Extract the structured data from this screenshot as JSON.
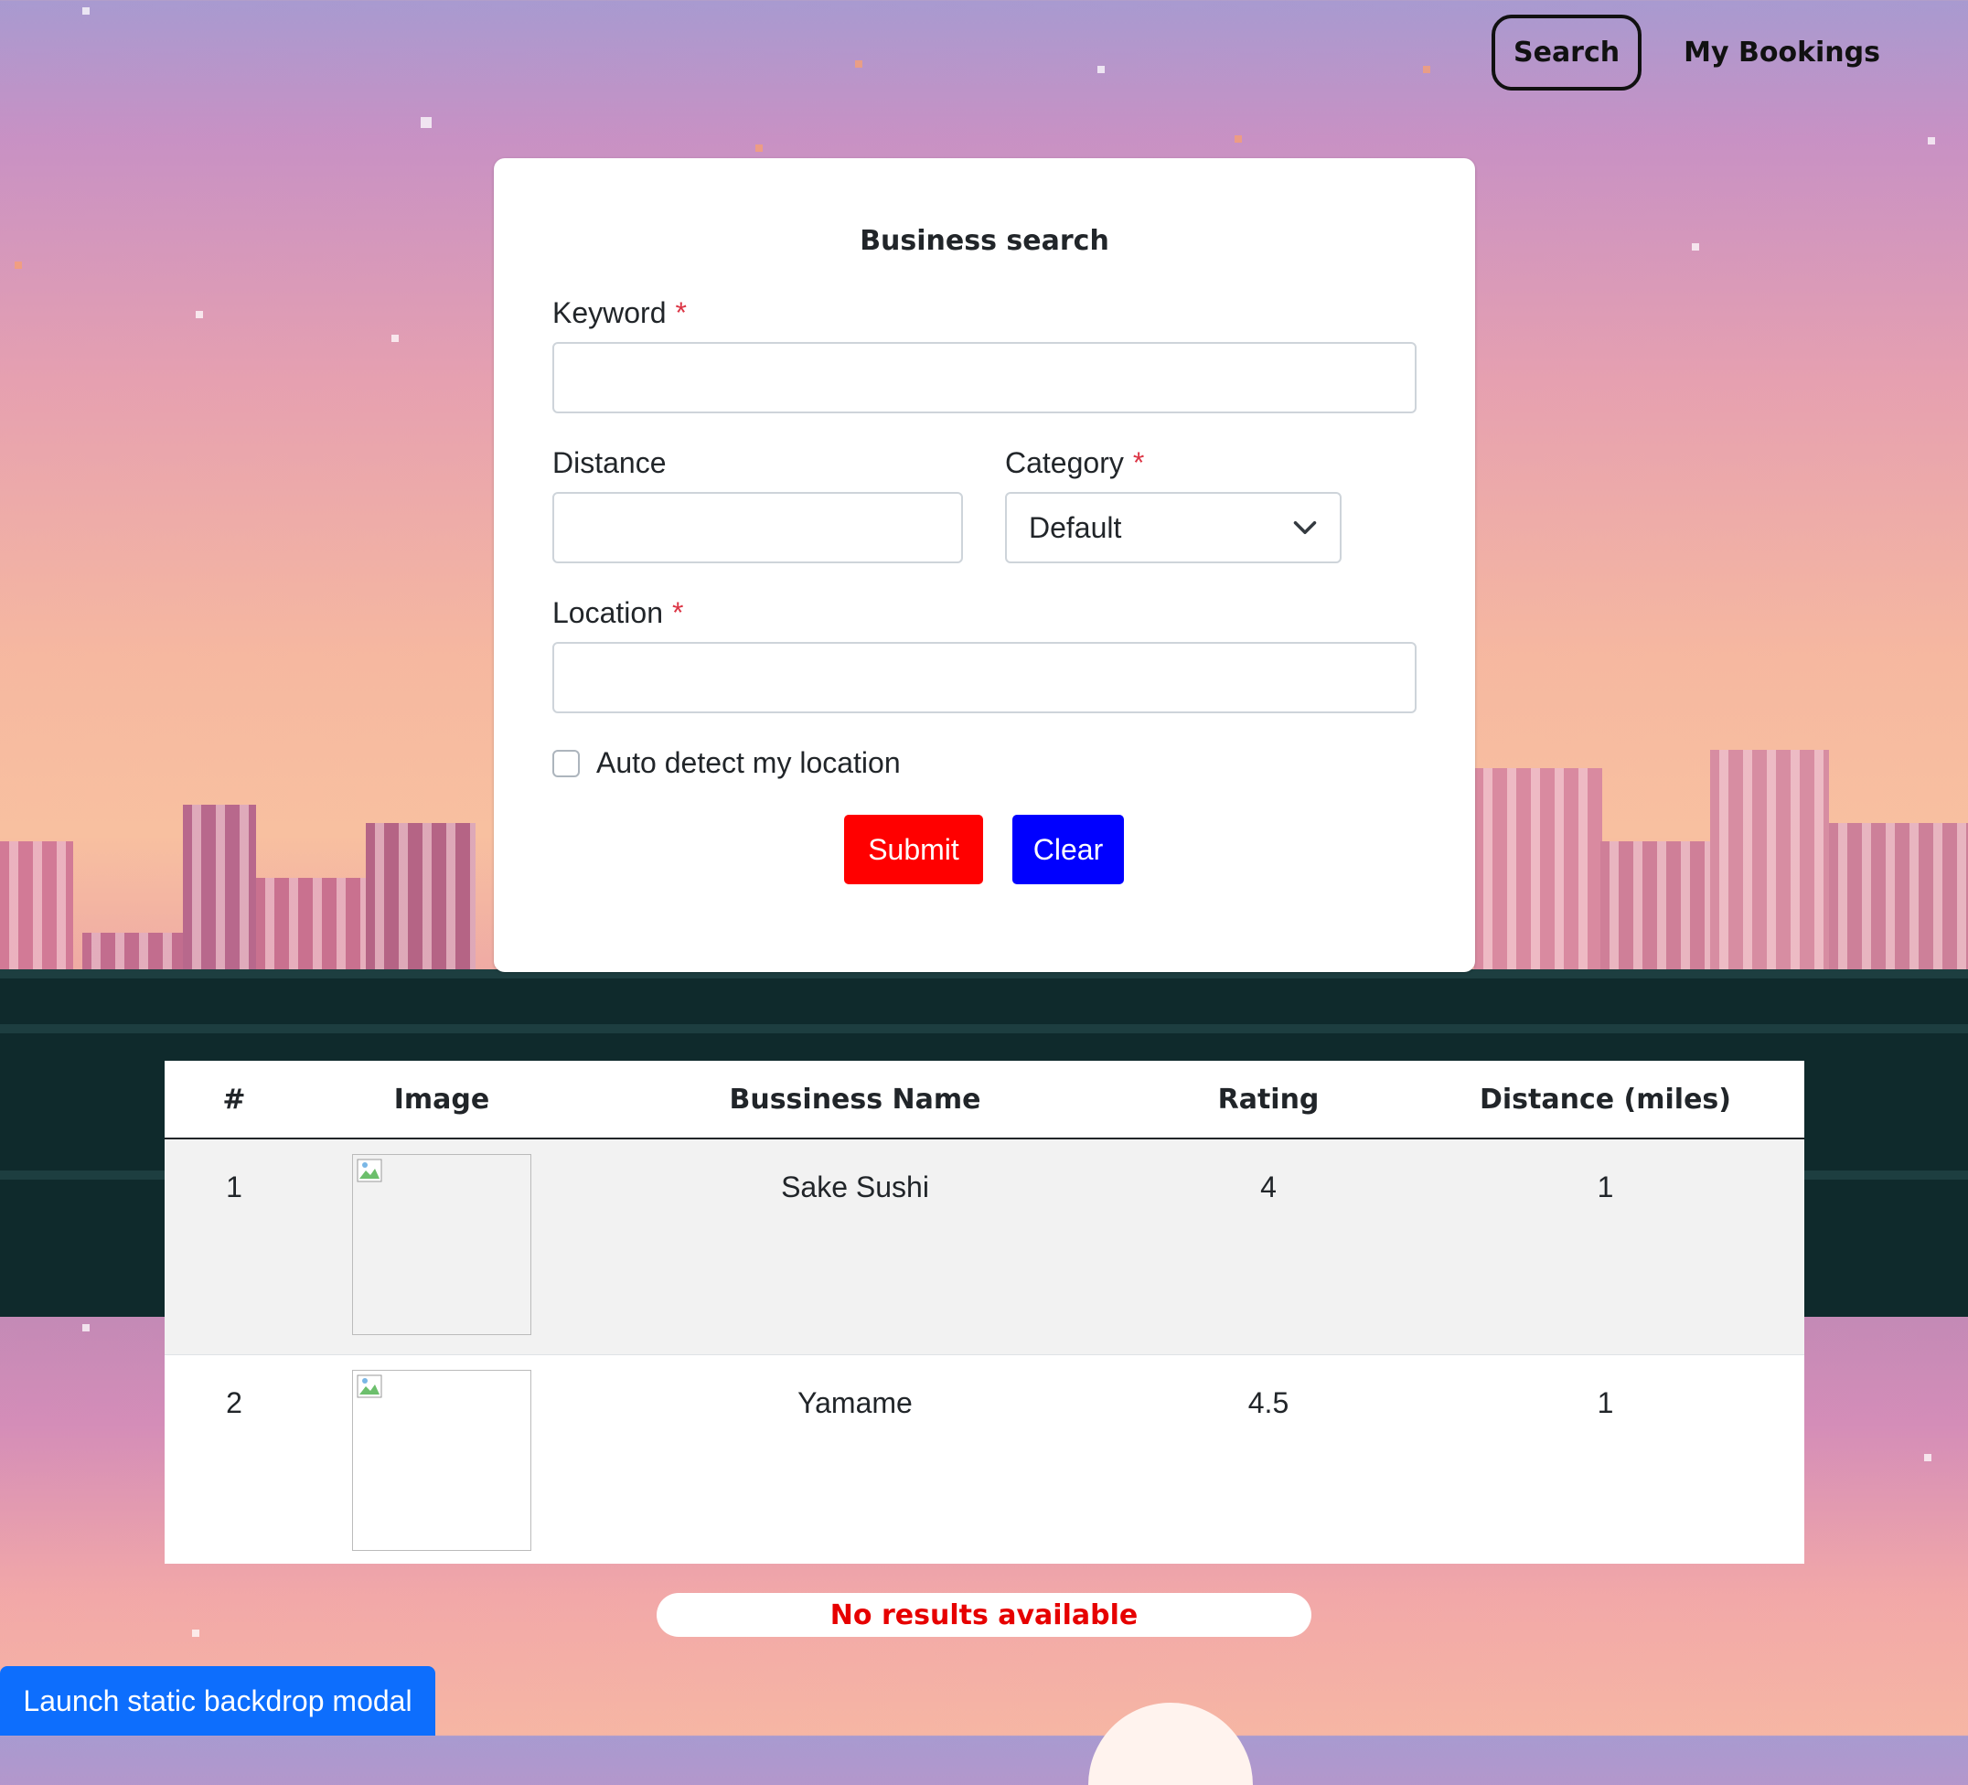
{
  "nav": {
    "search_label": "Search",
    "bookings_label": "My Bookings"
  },
  "form": {
    "title": "Business search",
    "keyword_label": "Keyword",
    "keyword_value": "",
    "distance_label": "Distance",
    "distance_value": "",
    "category_label": "Category",
    "category_selected": "Default",
    "location_label": "Location",
    "location_value": "",
    "required_mark": "*",
    "auto_detect_label": "Auto detect my location",
    "auto_detect_checked": false,
    "submit_label": "Submit",
    "clear_label": "Clear"
  },
  "table": {
    "headers": [
      "#",
      "Image",
      "Bussiness Name",
      "Rating",
      "Distance (miles)"
    ],
    "rows": [
      {
        "num": "1",
        "name": "Sake Sushi",
        "rating": "4",
        "distance": "1"
      },
      {
        "num": "2",
        "name": "Yamame",
        "rating": "4.5",
        "distance": "1"
      }
    ]
  },
  "status": {
    "no_results": "No results available"
  },
  "modal_button_label": "Launch static backdrop modal",
  "colors": {
    "submit": "#ff0000",
    "clear": "#0000ff",
    "no_results_text": "#e60000",
    "modal_button": "#0d6efd"
  }
}
